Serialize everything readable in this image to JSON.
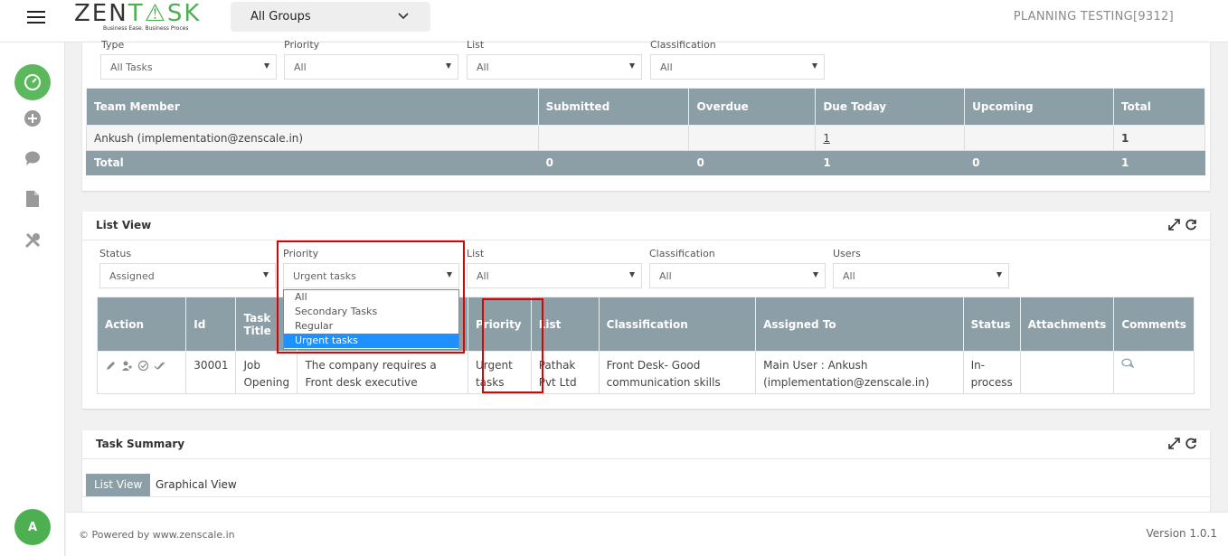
{
  "header": {
    "logo_text_a": "ZEN",
    "logo_text_b": "T",
    "logo_text_c": "SK",
    "logo_tagline": "Business Ease. Business Proces",
    "group_selector": "All Groups",
    "org_name": "PLANNING TESTING[9312]"
  },
  "sidebar": {
    "avatar_initial": "A"
  },
  "summary_panel": {
    "filters": [
      {
        "label": "Type",
        "value": "All Tasks"
      },
      {
        "label": "Priority",
        "value": "All"
      },
      {
        "label": "List",
        "value": "All"
      },
      {
        "label": "Classification",
        "value": "All"
      }
    ],
    "table": {
      "headers": [
        "Team Member",
        "Submitted",
        "Overdue",
        "Due Today",
        "Upcoming",
        "Total"
      ],
      "rows": [
        {
          "member": "Ankush (implementation@zenscale.in)",
          "submitted": "",
          "overdue": "",
          "due_today": "1",
          "upcoming": "",
          "total": "1"
        }
      ],
      "total_row": {
        "label": "Total",
        "submitted": "0",
        "overdue": "0",
        "due_today": "1",
        "upcoming": "0",
        "total": "1"
      }
    }
  },
  "list_view": {
    "title": "List View",
    "filters": [
      {
        "label": "Status",
        "value": "Assigned"
      },
      {
        "label": "Priority",
        "value": "Urgent tasks"
      },
      {
        "label": "List",
        "value": "All"
      },
      {
        "label": "Classification",
        "value": "All"
      },
      {
        "label": "Users",
        "value": "All"
      }
    ],
    "priority_options": [
      "All",
      "Secondary Tasks",
      "Regular",
      "Urgent tasks"
    ],
    "priority_selected_index": 3,
    "table": {
      "headers": [
        "Action",
        "Id",
        "Task Title",
        "",
        "Priority",
        "List",
        "Classification",
        "Assigned To",
        "Status",
        "Attachments",
        "Comments"
      ],
      "rows": [
        {
          "id": "30001",
          "task_title": "Job Opening",
          "description": "The company requires a Front desk executive",
          "priority": "Urgent tasks",
          "list": "Pathak Pvt Ltd",
          "classification": "Front Desk- Good communication skills",
          "assigned_to": "Main User : Ankush (implementation@zenscale.in)",
          "status": "In-process",
          "attachments": ""
        }
      ]
    }
  },
  "task_summary": {
    "title": "Task Summary",
    "tabs": [
      "List View",
      "Graphical View"
    ],
    "active_tab": 0
  },
  "footer": {
    "powered_by": "© Powered by www.zenscale.in",
    "version": "Version 1.0.1"
  },
  "colors": {
    "brand_green": "#4caf50",
    "table_header": "#8c9ea6",
    "highlight_red": "#e00000",
    "select_blue": "#1e90ff"
  }
}
